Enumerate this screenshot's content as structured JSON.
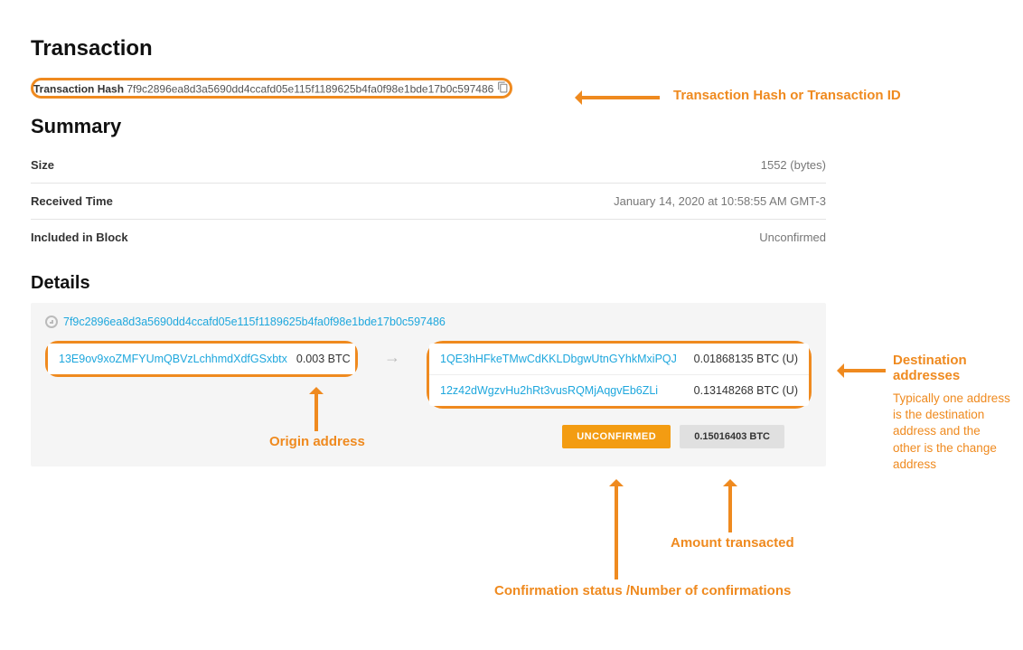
{
  "headings": {
    "transaction": "Transaction",
    "summary": "Summary",
    "details": "Details"
  },
  "hash": {
    "label": "Transaction Hash",
    "value": "7f9c2896ea8d3a5690dd4ccafd05e115f1189625b4fa0f98e1bde17b0c597486"
  },
  "summary": {
    "size_label": "Size",
    "size_value": "1552 (bytes)",
    "received_label": "Received Time",
    "received_value": "January 14, 2020 at 10:58:55 AM GMT-3",
    "block_label": "Included in Block",
    "block_value": "Unconfirmed"
  },
  "details": {
    "top_hash": "7f9c2896ea8d3a5690dd4ccafd05e115f1189625b4fa0f98e1bde17b0c597486",
    "inputs": [
      {
        "address": "13E9ov9xoZMFYUmQBVzLchhmdXdfGSxbtx",
        "amount": "0.003 BTC"
      }
    ],
    "outputs": [
      {
        "address": "1QE3hHFkeTMwCdKKLDbgwUtnGYhkMxiPQJ",
        "amount": "0.01868135 BTC (U)"
      },
      {
        "address": "12z42dWgzvHu2hRt3vusRQMjAqgvEb6ZLi",
        "amount": "0.13148268 BTC (U)"
      }
    ],
    "status_badge": "UNCONFIRMED",
    "total_badge": "0.15016403 BTC"
  },
  "annotations": {
    "hash": "Transaction Hash or Transaction ID",
    "origin": "Origin address",
    "dest_title": "Destination addresses",
    "dest_body": "Typically one address is the destination address and the other is the change address",
    "confirmation": "Confirmation status /Number of confirmations",
    "amount": "Amount transacted"
  }
}
